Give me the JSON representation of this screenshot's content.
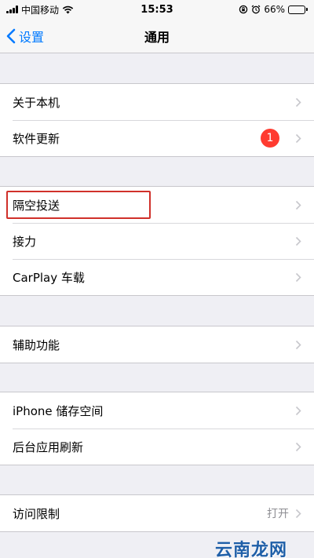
{
  "status_bar": {
    "carrier": "中国移动",
    "time": "15:53",
    "battery_percent": "66%",
    "battery_level": 0.66,
    "icons": [
      "signal-icon",
      "wifi-icon",
      "rotation-lock-icon",
      "alarm-icon",
      "battery-icon"
    ]
  },
  "nav": {
    "back_label": "设置",
    "title": "通用"
  },
  "groups": [
    {
      "items": [
        {
          "label": "关于本机"
        },
        {
          "label": "软件更新",
          "badge": "1"
        }
      ]
    },
    {
      "items": [
        {
          "label": "隔空投送"
        },
        {
          "label": "接力"
        },
        {
          "label": "CarPlay 车载"
        }
      ]
    },
    {
      "items": [
        {
          "label": "辅助功能"
        }
      ]
    },
    {
      "items": [
        {
          "label": "iPhone 储存空间"
        },
        {
          "label": "后台应用刷新"
        }
      ]
    },
    {
      "items": [
        {
          "label": "访问限制",
          "detail": "打开"
        }
      ]
    }
  ],
  "watermark": "云南龙网",
  "colors": {
    "accent": "#007aff",
    "badge": "#ff3b30",
    "highlight_border": "#d0302a",
    "background": "#efeff4"
  }
}
